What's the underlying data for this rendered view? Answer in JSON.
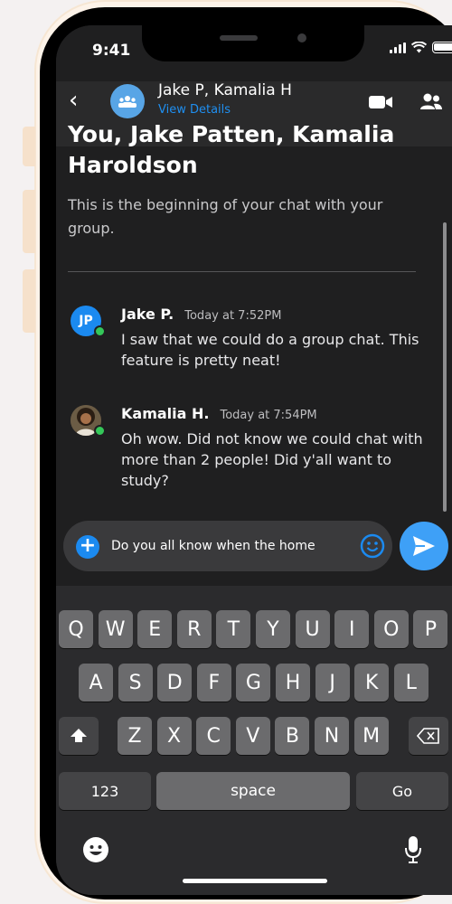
{
  "status_bar": {
    "time": "9:41"
  },
  "header": {
    "title": "Jake P, Kamalia H",
    "subtitle": "View Details",
    "back_icon": "chevron-left-icon",
    "video_icon": "video-call-icon",
    "people_icon": "group-members-icon"
  },
  "intro": {
    "title": "You, Jake Patten, Kamalia Haroldson",
    "text": "This is the beginning of your chat with your group."
  },
  "messages": [
    {
      "initials": "JP",
      "sender": "Jake P.",
      "time": "Today at 7:52PM",
      "text": "I saw that we could do a group chat. This feature is pretty neat!"
    },
    {
      "initials": "",
      "sender": "Kamalia H.",
      "time": "Today at 7:54PM",
      "text": "Oh wow. Did not know we could chat with more than 2 people! Did y'all want to study?"
    }
  ],
  "composer": {
    "value": "Do you all know when the home",
    "plus_icon": "+",
    "emoji_icon": "smiley-icon",
    "send_icon": "send-arrow-icon"
  },
  "keyboard": {
    "row1": [
      "Q",
      "W",
      "E",
      "R",
      "T",
      "Y",
      "U",
      "I",
      "O",
      "P"
    ],
    "row2": [
      "A",
      "S",
      "D",
      "F",
      "G",
      "H",
      "J",
      "K",
      "L"
    ],
    "row3": [
      "Z",
      "X",
      "C",
      "V",
      "B",
      "N",
      "M"
    ],
    "numbers_label": "123",
    "space_label": "space",
    "go_label": "Go"
  },
  "colors": {
    "accent": "#1b8af0",
    "online": "#34c759",
    "background": "#1f1f20"
  }
}
